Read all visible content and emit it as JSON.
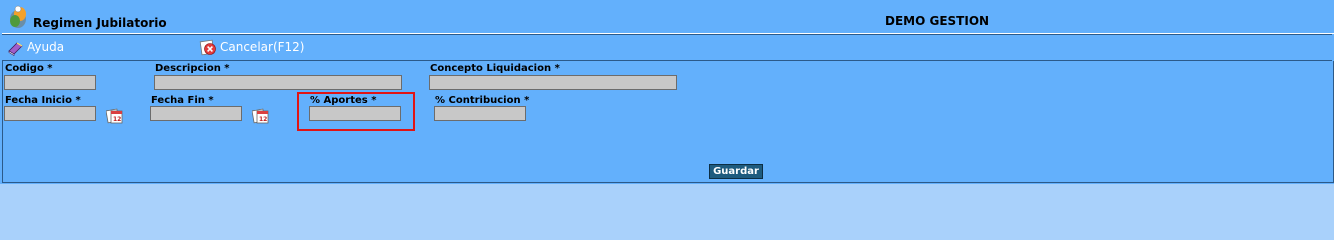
{
  "header": {
    "title": "Regimen Jubilatorio",
    "company": "DEMO GESTION"
  },
  "toolbar": {
    "help_label": "Ayuda",
    "cancel_label": "Cancelar(F12)"
  },
  "form": {
    "codigo": {
      "label": "Codigo *",
      "value": ""
    },
    "descripcion": {
      "label": "Descripcion *",
      "value": ""
    },
    "concepto": {
      "label": "Concepto Liquidacion *",
      "value": ""
    },
    "fecha_inicio": {
      "label": "Fecha Inicio *",
      "value": ""
    },
    "fecha_fin": {
      "label": "Fecha Fin *",
      "value": ""
    },
    "aportes": {
      "label": "% Aportes *",
      "value": ""
    },
    "contribucion": {
      "label": "% Contribucion *",
      "value": ""
    },
    "save_label": "Guardar"
  },
  "icons": {
    "logo": "app-logo-icon",
    "help": "book-help-icon",
    "cancel": "cancel-icon",
    "calendar": "calendar-icon"
  },
  "colors": {
    "background": "#63b0fc",
    "page_bottom": "#a9d1fb",
    "input": "#c8c8c8",
    "button": "#1e5b7e",
    "highlight": "#e11414"
  }
}
